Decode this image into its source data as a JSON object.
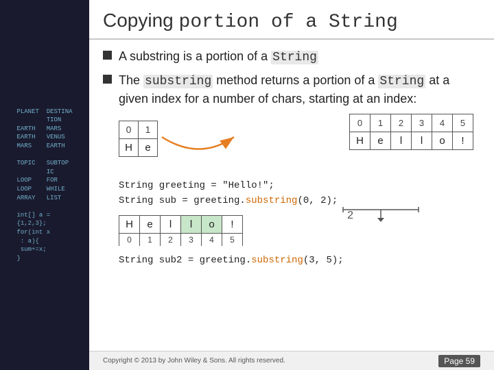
{
  "leftStrip": {
    "codeLines": [
      "PLANET  DESTINA",
      "        TION",
      "EARTH   MARS",
      "EARTH   VENUS",
      "MARS    EARTH",
      "        ",
      "TOPIC   SUBTOP",
      "        IC",
      "LOOP    FOR",
      "LOOP    WHILE",
      "ARRAY   LIST"
    ]
  },
  "title": {
    "prefix": "Copying ",
    "highlight": "portion of a",
    "suffix": " String"
  },
  "bullets": [
    {
      "text_before": "A substring is a portion of a ",
      "mono": "String",
      "text_after": ""
    },
    {
      "text_before": "The ",
      "mono": "substring",
      "text_after": " method returns a portion of a ",
      "mono2": "String",
      "text_after2": " at a given index for a number of chars, starting at an index:"
    }
  ],
  "smallTable": {
    "headers": [
      "0",
      "1"
    ],
    "values": [
      "H",
      "e"
    ]
  },
  "largeTable": {
    "headers": [
      "0",
      "1",
      "2",
      "3",
      "4",
      "5"
    ],
    "values": [
      "H",
      "e",
      "l",
      "l",
      "o",
      "!"
    ]
  },
  "codeLines": [
    "String greeting = \"Hello!\";",
    "String sub = greeting.substring(0, 2);"
  ],
  "helloTable": {
    "values": [
      "H",
      "e",
      "l",
      "l",
      "o",
      "!"
    ],
    "indexes": [
      "0",
      "1",
      "2",
      "3",
      "4",
      "5"
    ],
    "highlightCols": [
      3,
      4
    ]
  },
  "numLabel": "2",
  "sub2Code": "String sub2 = greeting.substring(3, 5);",
  "footer": {
    "copyright": "Copyright © 2013 by John Wiley & Sons.  All rights reserved.",
    "page": "Page 59"
  }
}
